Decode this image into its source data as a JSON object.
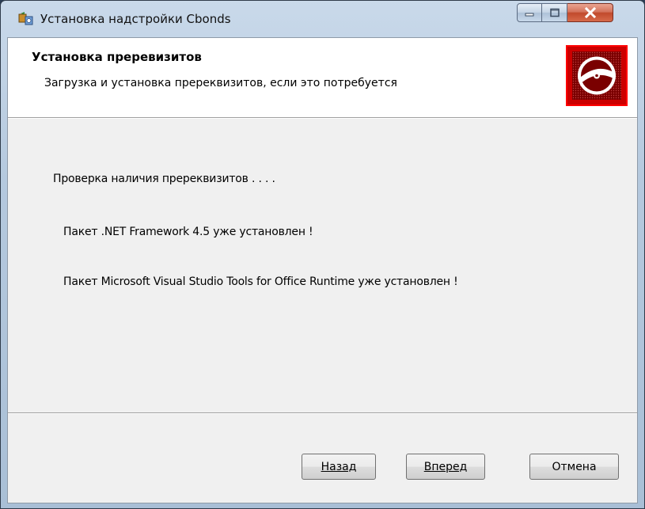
{
  "window": {
    "title": "Установка надстройки Cbonds",
    "controls": {
      "minimize_icon": "minimize-icon",
      "maximize_icon": "maximize-icon",
      "close_icon": "close-icon"
    }
  },
  "header": {
    "title": "Установка преревизитов",
    "subtitle": "Загрузка и установка пререквизитов, если это потребуется",
    "logo_icon": "disc-logo-icon"
  },
  "messages": [
    "Проверка наличия пререквизитов . . . .",
    "Пакет .NET Framework 4.5 уже установлен !",
    "Пакет Microsoft Visual Studio Tools for Office Runtime уже установлен !"
  ],
  "buttons": {
    "back": "Назад",
    "next": "Вперед",
    "cancel": "Отмена"
  },
  "colors": {
    "logo_red": "#cc0000",
    "logo_dark": "#7a0000",
    "close_red": "#c14a2c"
  }
}
